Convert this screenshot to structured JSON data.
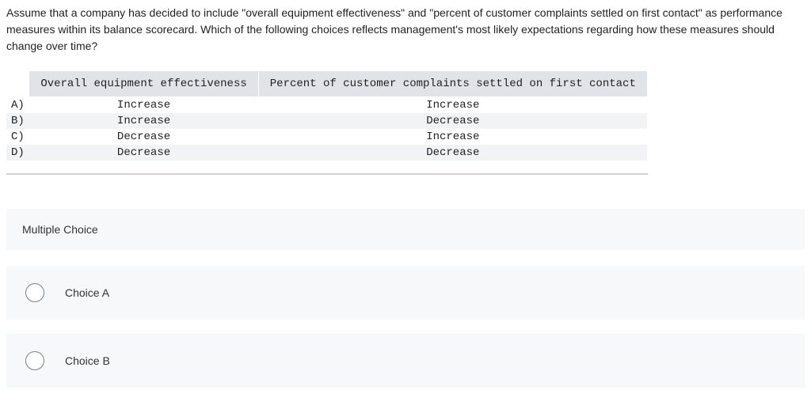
{
  "question": "Assume that a company has decided to include \"overall equipment effectiveness\" and \"percent of customer complaints settled on first contact\" as performance measures within its balance scorecard. Which of the following choices reflects management's most likely expectations regarding how these measures should change over time?",
  "table": {
    "headers": {
      "col1": "Overall equipment effectiveness",
      "col2": "Percent of customer complaints settled on first contact"
    },
    "rows": [
      {
        "label": "A)",
        "col1": "Increase",
        "col2": "Increase"
      },
      {
        "label": "B)",
        "col1": "Increase",
        "col2": "Decrease"
      },
      {
        "label": "C)",
        "col1": "Decrease",
        "col2": "Increase"
      },
      {
        "label": "D)",
        "col1": "Decrease",
        "col2": "Decrease"
      }
    ]
  },
  "mc_heading": "Multiple Choice",
  "options": [
    {
      "label": "Choice A"
    },
    {
      "label": "Choice B"
    }
  ]
}
